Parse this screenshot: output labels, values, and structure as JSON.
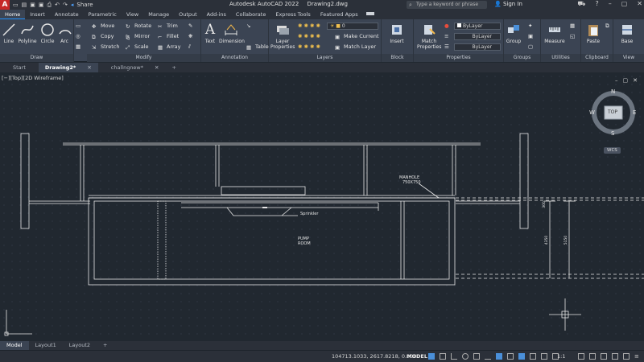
{
  "app": {
    "logo": "A",
    "title": "Autodesk AutoCAD 2022",
    "filename": "Drawing2.dwg",
    "share_label": "Share",
    "search_placeholder": "Type a keyword or phrase",
    "signin_label": "Sign In"
  },
  "ribbon_tabs": [
    "Home",
    "Insert",
    "Annotate",
    "Parametric",
    "View",
    "Manage",
    "Output",
    "Add-ins",
    "Collaborate",
    "Express Tools",
    "Featured Apps"
  ],
  "ribbon": {
    "draw": {
      "label": "Draw",
      "line": "Line",
      "polyline": "Polyline",
      "circle": "Circle",
      "arc": "Arc"
    },
    "modify": {
      "label": "Modify",
      "move": "Move",
      "rotate": "Rotate",
      "trim": "Trim",
      "copy": "Copy",
      "mirror": "Mirror",
      "fillet": "Fillet",
      "stretch": "Stretch",
      "scale": "Scale",
      "array": "Array"
    },
    "annotation": {
      "label": "Annotation",
      "text": "Text",
      "dimension": "Dimension",
      "table": "Table"
    },
    "layers": {
      "label": "Layers",
      "layer_props_1": "Layer",
      "layer_props_2": "Properties",
      "current_layer": "0",
      "make_current": "Make Current",
      "match_layer": "Match Layer"
    },
    "block": {
      "label": "Block",
      "insert": "Insert"
    },
    "properties": {
      "label": "Properties",
      "match_1": "Match",
      "match_2": "Properties",
      "bylayer": "ByLayer"
    },
    "groups": {
      "label": "Groups",
      "group": "Group"
    },
    "utilities": {
      "label": "Utilities",
      "measure": "Measure"
    },
    "clipboard": {
      "label": "Clipboard",
      "paste": "Paste"
    },
    "view": {
      "label": "View",
      "base": "Base"
    }
  },
  "file_tabs": [
    {
      "label": "Start",
      "active": false
    },
    {
      "label": "Drawing2*",
      "active": true
    },
    {
      "label": "challngnew*",
      "active": false
    }
  ],
  "viewport": {
    "label": "[−][Top][2D Wireframe]",
    "cube_top": "TOP",
    "n": "N",
    "s": "S",
    "e": "E",
    "w": "W",
    "wcs": "WCS"
  },
  "drawing_text": {
    "manhole_1": "MANHOLE",
    "manhole_2": "750X750",
    "sprinkler": "Sprinkler",
    "pump_1": "PUMP",
    "pump_2": "ROOM",
    "dim_1": "300",
    "dim_2": "4350",
    "dim_3": "5150"
  },
  "layout_tabs": [
    {
      "label": "Model",
      "active": true
    },
    {
      "label": "Layout1",
      "active": false
    },
    {
      "label": "Layout2",
      "active": false
    }
  ],
  "status": {
    "coords": "104713.1033, 2617.8218, 0.0000",
    "model": "MODEL",
    "scale": "1:1"
  },
  "colors": {
    "accent": "#1e90ff",
    "canvas": "#212830",
    "ribbon": "#3b4453",
    "logo_red": "#c62828"
  }
}
